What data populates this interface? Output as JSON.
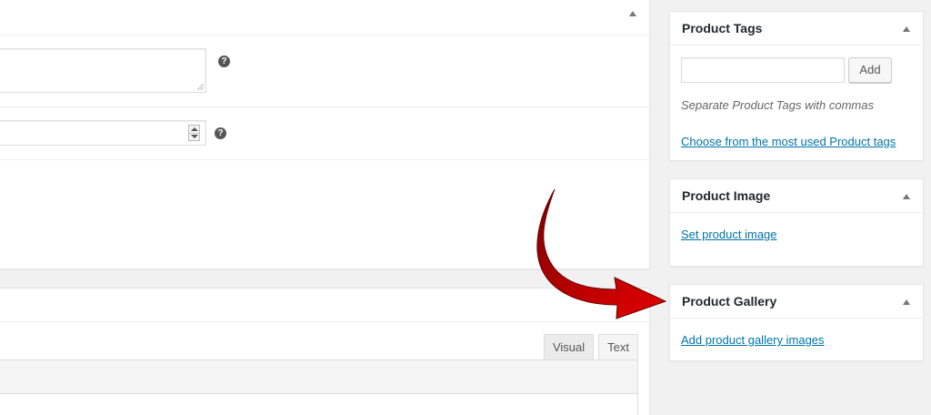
{
  "main_box": {
    "help_icon": "?",
    "help_icon_2": "?"
  },
  "editor": {
    "tab_visual": "Visual",
    "tab_text": "Text"
  },
  "sidebar": {
    "tags": {
      "title": "Product Tags",
      "input_value": "",
      "add_label": "Add",
      "hint": "Separate Product Tags with commas",
      "link": "Choose from the most used Product tags"
    },
    "image": {
      "title": "Product Image",
      "link": "Set product image"
    },
    "gallery": {
      "title": "Product Gallery",
      "link": "Add product gallery images"
    }
  },
  "colors": {
    "link": "#0073aa",
    "arrow": "#c00000",
    "background": "#f1f1f1"
  },
  "icons": [
    "collapse-toggle-icon",
    "help-icon",
    "resize-grip-icon",
    "spinner-icon",
    "red-arrow-icon"
  ]
}
